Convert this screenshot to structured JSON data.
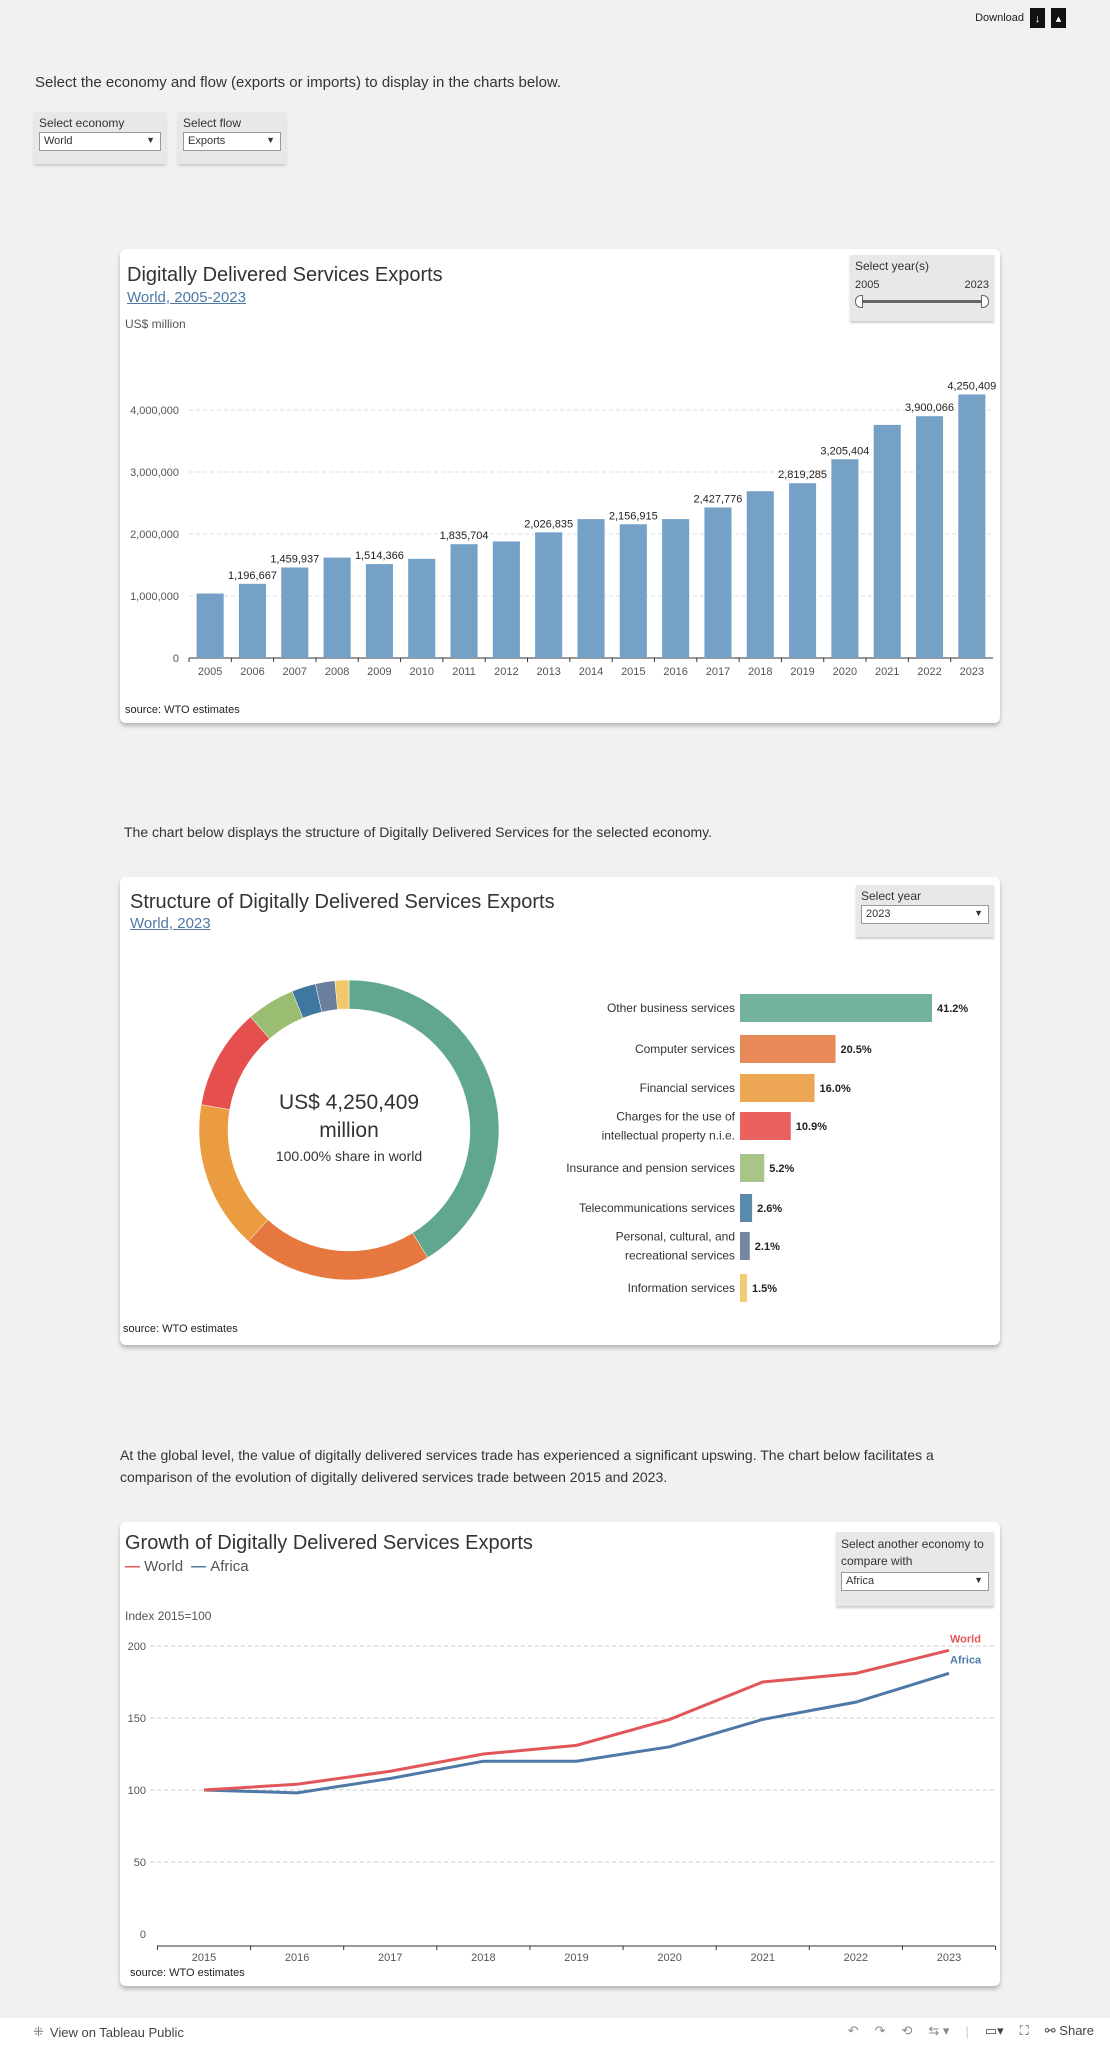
{
  "header": {
    "download_label": "Download",
    "icons": [
      "download-data-icon",
      "download-image-icon"
    ]
  },
  "intro": "Select the economy and flow (exports or imports) to display in the charts below.",
  "filters": {
    "economy": {
      "label": "Select economy",
      "value": "World"
    },
    "flow": {
      "label": "Select flow",
      "value": "Exports"
    }
  },
  "card1": {
    "title": "Digitally Delivered Services Exports",
    "subtitle": "World, 2005-2023",
    "slider": {
      "label": "Select year(s)",
      "min": "2005",
      "max": "2023",
      "range": [
        2005,
        2023
      ]
    },
    "source": "source: WTO estimates"
  },
  "text2": "The chart below displays the structure of Digitally Delivered Services for the selected economy.",
  "card2": {
    "title": "Structure of Digitally Delivered Services Exports",
    "subtitle": "World, 2023",
    "year_select": {
      "label": "Select year",
      "value": "2023"
    },
    "center_value": "US$ 4,250,409",
    "center_unit": "million",
    "center_share": "100.00% share in world",
    "source": "source: WTO estimates"
  },
  "text3": "At the global level, the value of digitally delivered services trade has experienced a significant upswing. The chart below facilitates a comparison of the evolution of digitally delivered services trade between 2015 and 2023.",
  "card3": {
    "title": "Growth of Digitally Delivered Services Exports",
    "compare_select": {
      "label": "Select another economy to compare with",
      "value": "Africa"
    },
    "source": "source: WTO estimates"
  },
  "footer": {
    "view_label": "View on Tableau Public",
    "share_label": "Share"
  },
  "chart_data": [
    {
      "type": "bar",
      "ylabel": "US$ million",
      "ylim": [
        0,
        4400000
      ],
      "yticks": [
        "0",
        "1,000,000",
        "2,000,000",
        "3,000,000",
        "4,000,000"
      ],
      "color": "#75a1c7",
      "grid": true,
      "categories": [
        "2005",
        "2006",
        "2007",
        "2008",
        "2009",
        "2010",
        "2011",
        "2012",
        "2013",
        "2014",
        "2015",
        "2016",
        "2017",
        "2018",
        "2019",
        "2020",
        "2021",
        "2022",
        "2023"
      ],
      "values": [
        1040000,
        1196667,
        1459937,
        1620000,
        1514366,
        1600000,
        1835704,
        1880000,
        2026835,
        2240000,
        2156915,
        2240000,
        2427776,
        2690000,
        2819285,
        3205404,
        3760000,
        3900066,
        4250409
      ],
      "labels": [
        "",
        "1,196,667",
        "1,459,937",
        "",
        "1,514,366",
        "",
        "1,835,704",
        "",
        "2,026,835",
        "",
        "2,156,915",
        "",
        "2,427,776",
        "",
        "2,819,285",
        "3,205,404",
        "",
        "3,900,066",
        "4,250,409"
      ]
    },
    {
      "type": "pie",
      "donut": true,
      "categories": [
        "Other business services",
        "Computer services",
        "Financial services",
        "Charges for the use of intellectual property n.i.e.",
        "Insurance and pension services",
        "Telecommunications services",
        "Personal, cultural, and recreational services",
        "Information services"
      ],
      "values": [
        41.2,
        20.5,
        16.0,
        10.9,
        5.2,
        2.6,
        2.1,
        1.5
      ],
      "labels": [
        "41.2%",
        "20.5%",
        "16.0%",
        "10.9%",
        "5.2%",
        "2.6%",
        "2.1%",
        "1.5%"
      ],
      "colors": [
        "#61a78d",
        "#e5773f",
        "#eb9c40",
        "#e5504f",
        "#9bbd72",
        "#3e77a0",
        "#6a7f9c",
        "#f2c86b"
      ],
      "bar_colors": [
        "#73b39b",
        "#e88a57",
        "#eda653",
        "#e9625f",
        "#a6c586",
        "#5a8bac",
        "#7787a0",
        "#f2cb77"
      ]
    },
    {
      "type": "line",
      "ylabel": "Index 2015=100",
      "ylim": [
        0,
        200
      ],
      "yticks": [
        "0",
        "50",
        "100",
        "150",
        "200"
      ],
      "grid": true,
      "x": [
        "2015",
        "2016",
        "2017",
        "2018",
        "2019",
        "2020",
        "2021",
        "2022",
        "2023"
      ],
      "series": [
        {
          "name": "World",
          "color": "#e15759",
          "values": [
            100,
            104,
            113,
            125,
            131,
            149,
            175,
            181,
            197
          ]
        },
        {
          "name": "Africa",
          "color": "#4e79a7",
          "values": [
            100,
            98,
            108,
            120,
            120,
            130,
            149,
            161,
            181
          ]
        }
      ]
    }
  ]
}
